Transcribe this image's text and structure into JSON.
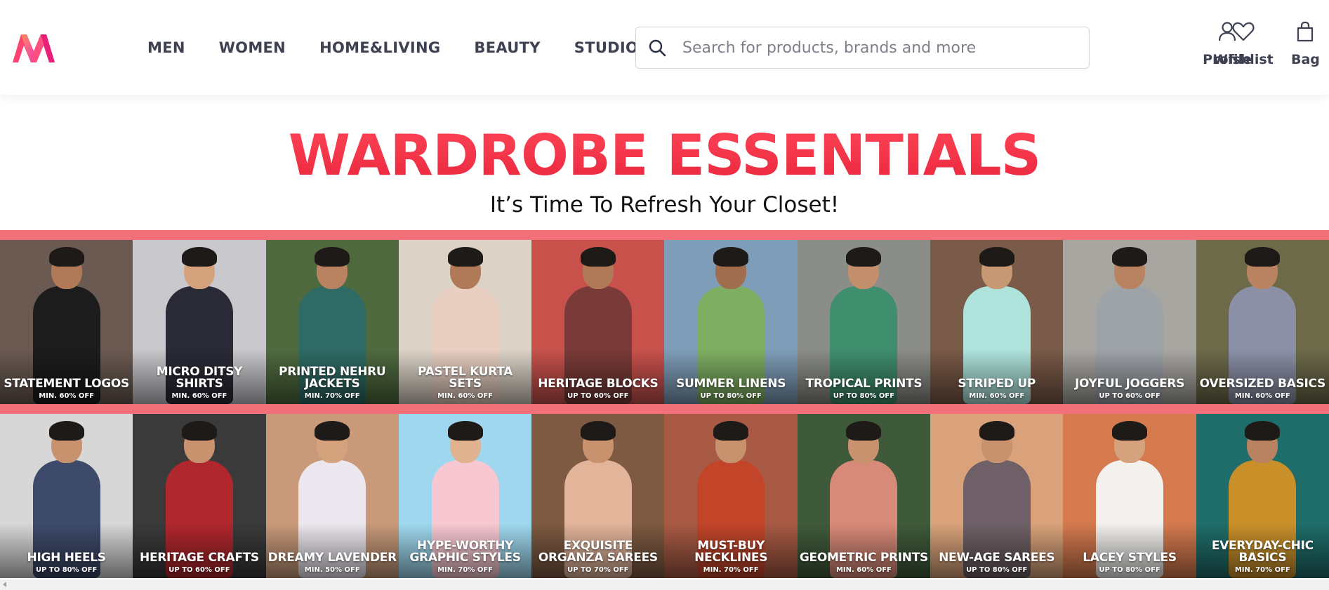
{
  "header": {
    "logo_alt": "Myntra",
    "nav": [
      "MEN",
      "WOMEN",
      "HOME&LIVING",
      "BEAUTY",
      "STUDIO"
    ],
    "search": {
      "placeholder": "Search for products, brands and more",
      "icon": "search-icon"
    },
    "actions": [
      {
        "label": "Profile",
        "icon": "user-icon"
      },
      {
        "label": "Wishlist",
        "icon": "heart-icon"
      },
      {
        "label": "Bag",
        "icon": "bag-icon"
      }
    ]
  },
  "banner": {
    "title": "WARDROBE ESSENTIALS",
    "subtitle": "It’s Time To Refresh Your Closet!"
  },
  "colors": {
    "brand_pink": "#ff3f6c",
    "banner_red": "#f0354a",
    "band": "#f2707a"
  },
  "men_tiles": [
    {
      "title": "STATEMENT LOGOS",
      "offer": "MIN. 60% OFF",
      "bg": "#6b5a52",
      "outfit": "#1c1c1c",
      "skin": "#b07a58"
    },
    {
      "title": "MICRO DITSY SHIRTS",
      "offer": "MIN. 60% OFF",
      "bg": "#c9c9cd",
      "outfit": "#2a2a36",
      "skin": "#d5a27e"
    },
    {
      "title": "PRINTED NEHRU JACKETS",
      "offer": "MIN. 70% OFF",
      "bg": "#4f6a3f",
      "outfit": "#2f6a64",
      "skin": "#b98361"
    },
    {
      "title": "PASTEL KURTA SETS",
      "offer": "MIN. 60% OFF",
      "bg": "#dcd3c6",
      "outfit": "#e8cfc2",
      "skin": "#b07a58"
    },
    {
      "title": "HERITAGE BLOCKS",
      "offer": "UP TO 60% OFF",
      "bg": "#c8514c",
      "outfit": "#7a3b38",
      "skin": "#b07a58"
    },
    {
      "title": "SUMMER LINENS",
      "offer": "UP TO 80% OFF",
      "bg": "#7f9db8",
      "outfit": "#7fae62",
      "skin": "#a06e4e"
    },
    {
      "title": "TROPICAL PRINTS",
      "offer": "UP TO 80% OFF",
      "bg": "#8b8d88",
      "outfit": "#3f8e6e",
      "skin": "#c38f6c"
    },
    {
      "title": "STRIPED UP",
      "offer": "MIN. 60% OFF",
      "bg": "#7a5a48",
      "outfit": "#aee3dc",
      "skin": "#c69874"
    },
    {
      "title": "JOYFUL JOGGERS",
      "offer": "UP TO 60% OFF",
      "bg": "#a8a6a1",
      "outfit": "#9ea3a8",
      "skin": "#b98361"
    },
    {
      "title": "OVERSIZED BASICS",
      "offer": "MIN. 60% OFF",
      "bg": "#6d6a4a",
      "outfit": "#8b90a6",
      "skin": "#b98361"
    }
  ],
  "women_tiles": [
    {
      "title": "HIGH HEELS",
      "offer": "UP TO 80% OFF",
      "bg": "#d7d7d7",
      "outfit": "#3d4a6a",
      "skin": "#c9926e"
    },
    {
      "title": "HERITAGE CRAFTS",
      "offer": "UP TO 60% OFF",
      "bg": "#3a3a3a",
      "outfit": "#b0272e",
      "skin": "#c9926e"
    },
    {
      "title": "DREAMY LAVENDER",
      "offer": "MIN. 50% OFF",
      "bg": "#c89a7a",
      "outfit": "#ece7ee",
      "skin": "#d5a27e"
    },
    {
      "title": "HYPE-WORTHY GRAPHIC STYLES",
      "offer": "MIN. 70% OFF",
      "bg": "#9fd8ee",
      "outfit": "#f7c8d2",
      "skin": "#e0b290"
    },
    {
      "title": "EXQUISITE ORGANZA SAREES",
      "offer": "UP TO 70% OFF",
      "bg": "#7d5a41",
      "outfit": "#e2b49a",
      "skin": "#c9926e"
    },
    {
      "title": "MUST-BUY NECKLINES",
      "offer": "MIN. 70% OFF",
      "bg": "#a85a44",
      "outfit": "#c2452a",
      "skin": "#c9926e"
    },
    {
      "title": "GEOMETRIC PRINTS",
      "offer": "MIN. 60% OFF",
      "bg": "#3f5a3a",
      "outfit": "#d88a78",
      "skin": "#c9926e"
    },
    {
      "title": "NEW-AGE SAREES",
      "offer": "UP TO 80% OFF",
      "bg": "#d9a27a",
      "outfit": "#6e6066",
      "skin": "#c9926e"
    },
    {
      "title": "LACEY STYLES",
      "offer": "UP TO 80% OFF",
      "bg": "#d47a4e",
      "outfit": "#f3f1ee",
      "skin": "#d5a27e"
    },
    {
      "title": "EVERYDAY-CHIC BASICS",
      "offer": "MIN. 70% OFF",
      "bg": "#1f6d6a",
      "outfit": "#c9902a",
      "skin": "#b98361"
    }
  ]
}
